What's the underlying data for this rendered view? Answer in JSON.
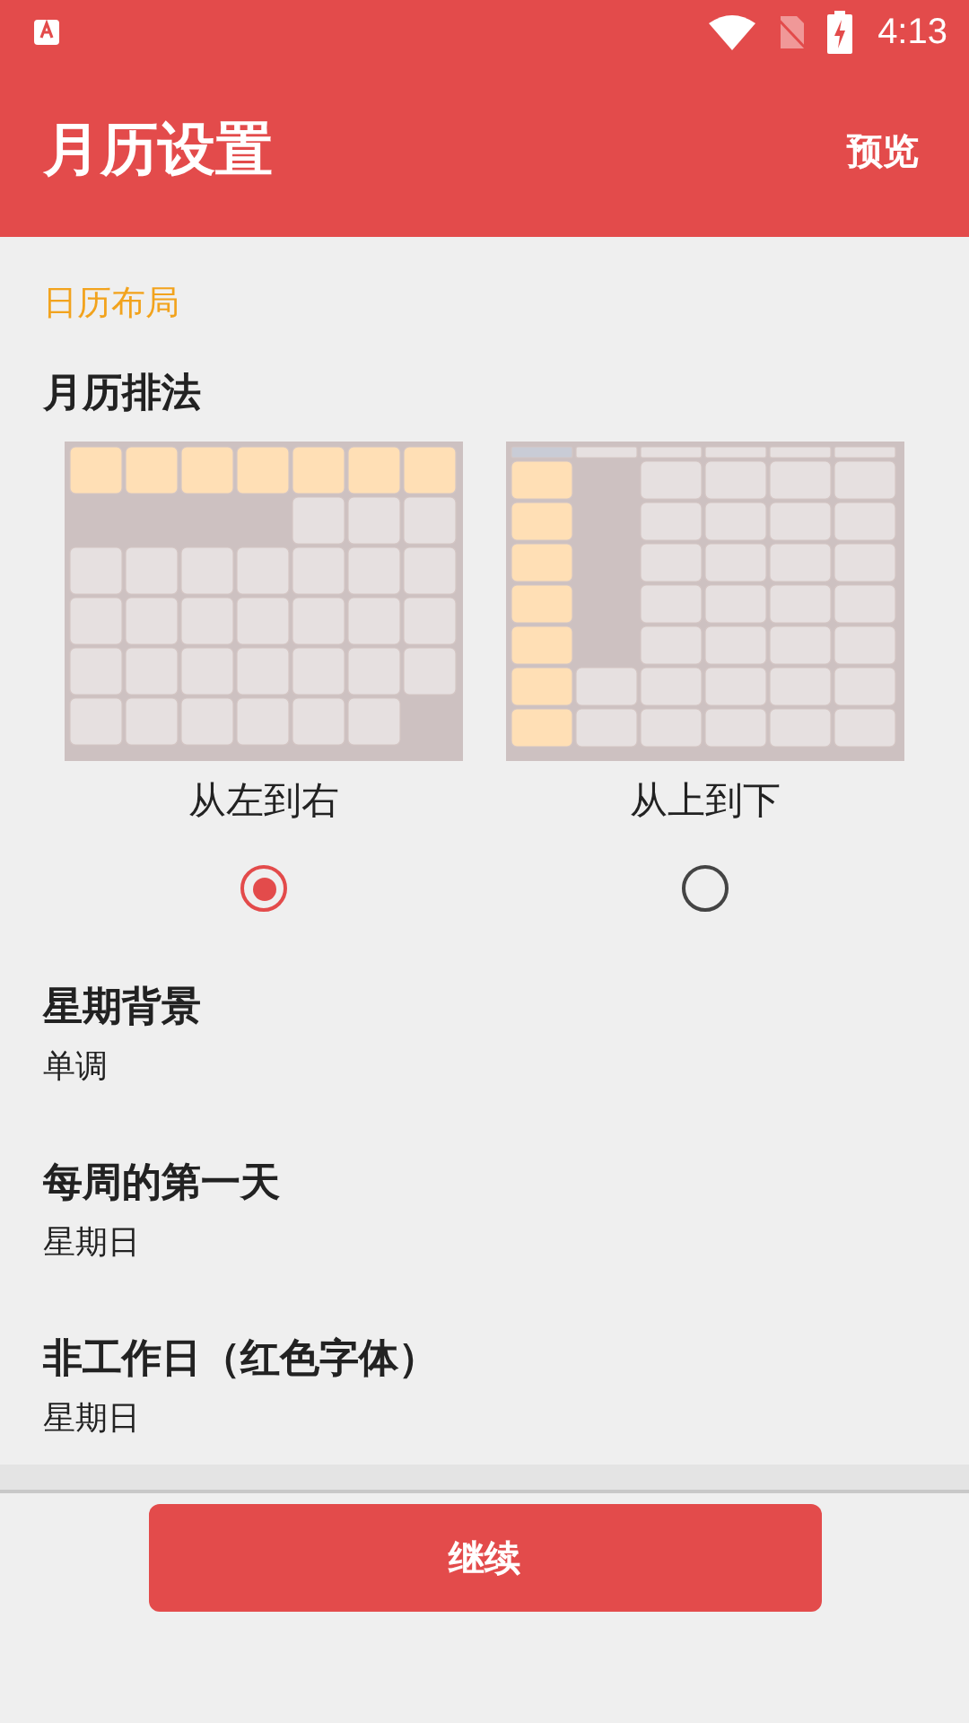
{
  "status_bar": {
    "time": "4:13"
  },
  "app_bar": {
    "title": "月历设置",
    "action": "预览"
  },
  "section_header": "日历布局",
  "layout": {
    "label": "月历排法",
    "options": [
      {
        "kind": "horizontal",
        "label": "从左到右",
        "selected": true
      },
      {
        "kind": "vertical",
        "label": "从上到下",
        "selected": false
      }
    ]
  },
  "settings": [
    {
      "title": "星期背景",
      "value": "单调"
    },
    {
      "title": "每周的第一天",
      "value": "星期日"
    },
    {
      "title": "非工作日（红色字体）",
      "value": "星期日"
    }
  ],
  "continue_button": "继续"
}
